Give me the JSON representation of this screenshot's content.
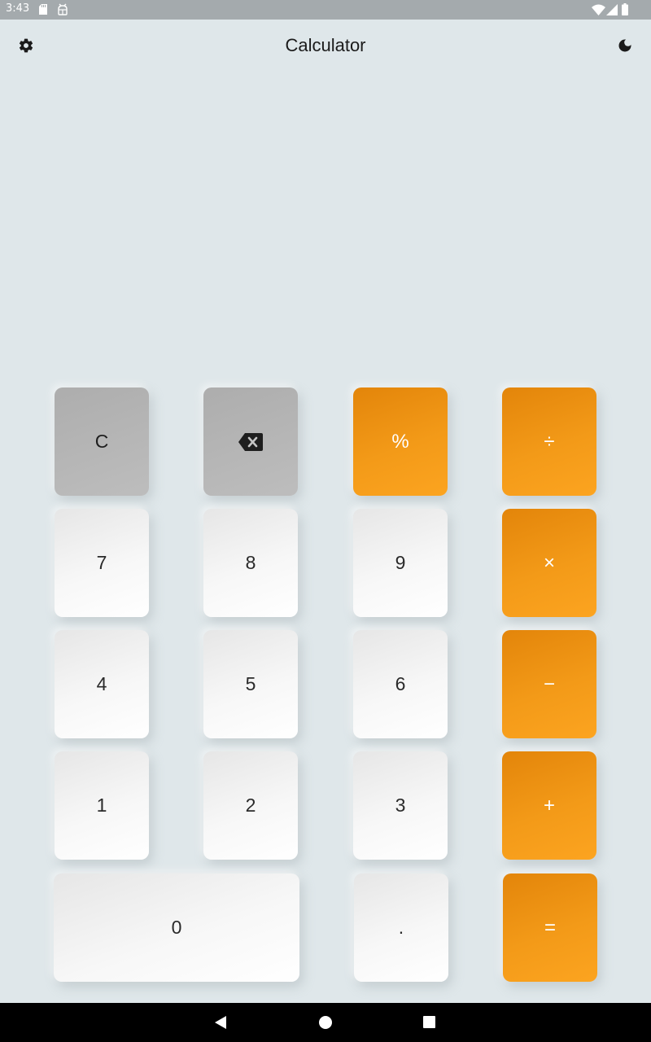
{
  "status_bar": {
    "time": "3:43",
    "icons": [
      "sd-card-icon",
      "usb-debug-icon",
      "wifi-icon",
      "signal-icon",
      "battery-icon"
    ]
  },
  "app_bar": {
    "title": "Calculator",
    "left_icon": "gear-icon",
    "right_icon": "moon-icon"
  },
  "display": {
    "expression": "",
    "result": ""
  },
  "keypad": {
    "clear": "C",
    "backspace_icon": "backspace-icon",
    "percent": "%",
    "divide": "÷",
    "seven": "7",
    "eight": "8",
    "nine": "9",
    "multiply": "×",
    "four": "4",
    "five": "5",
    "six": "6",
    "minus": "−",
    "one": "1",
    "two": "2",
    "three": "3",
    "plus": "+",
    "zero": "0",
    "decimal": ".",
    "equals": "="
  },
  "colors": {
    "background": "#dfe7ea",
    "operator": "#f39a18",
    "function": "#b5b5b5",
    "number": "#f5f5f5"
  },
  "nav_bar": {
    "icons": [
      "back-icon",
      "home-icon",
      "recents-icon"
    ]
  }
}
